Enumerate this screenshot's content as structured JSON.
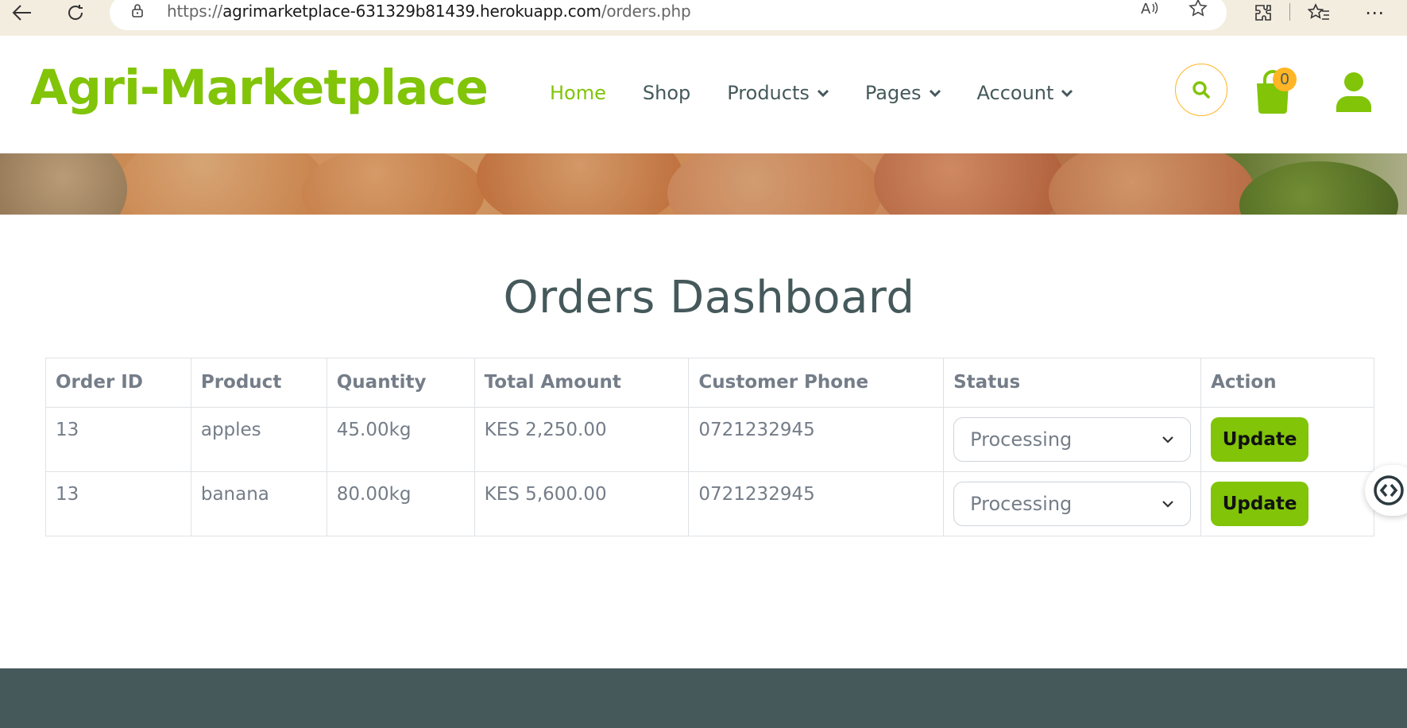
{
  "browser": {
    "url_prefix": "https://",
    "url_host": "agrimarketplace-631329b81439.herokuapp.com",
    "url_path": "/orders.php"
  },
  "header": {
    "logo": "Agri-Marketplace",
    "menu": [
      "Home",
      "Shop",
      "Products",
      "Pages",
      "Account"
    ],
    "cart_count": "0"
  },
  "main": {
    "title": "Orders Dashboard",
    "columns": [
      "Order ID",
      "Product",
      "Quantity",
      "Total Amount",
      "Customer Phone",
      "Status",
      "Action"
    ],
    "rows": [
      {
        "order_id": "13",
        "product": "apples",
        "quantity": "45.00kg",
        "total": "KES 2,250.00",
        "phone": "0721232945",
        "status": "Processing",
        "action": "Update"
      },
      {
        "order_id": "13",
        "product": "banana",
        "quantity": "80.00kg",
        "total": "KES 5,600.00",
        "phone": "0721232945",
        "status": "Processing",
        "action": "Update"
      }
    ]
  },
  "colors": {
    "brand_green": "#81c408",
    "accent_orange": "#ffb524",
    "text_dark": "#45595b",
    "footer": "#45595b"
  }
}
